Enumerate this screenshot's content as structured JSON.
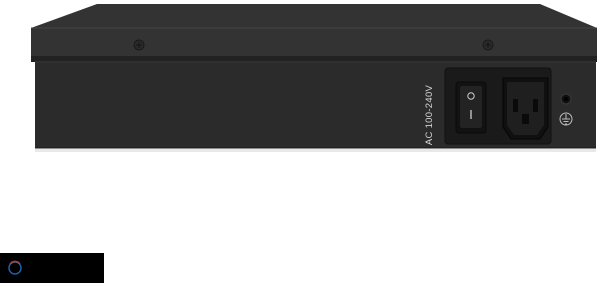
{
  "device": {
    "rear_label": "AC 100-240V",
    "power_switch": {
      "on_symbol": "I",
      "off_symbol": "O"
    },
    "icons": [
      "power-switch-icon",
      "iec-c14-inlet-icon",
      "ground-terminal-icon",
      "screw-icon"
    ]
  },
  "colors": {
    "chassis_top": "#2f2f2f",
    "chassis_face": "#282828",
    "panel": "#1c1c1c",
    "background": "#ffffff"
  }
}
